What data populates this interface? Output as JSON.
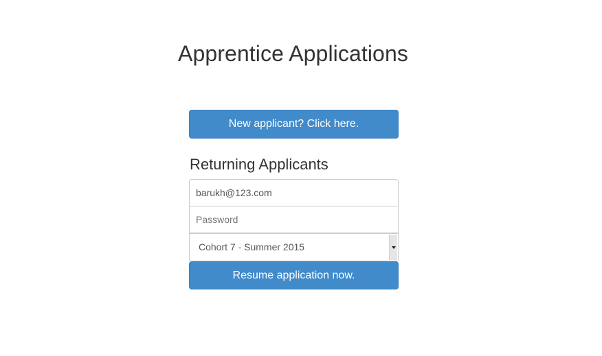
{
  "page": {
    "title": "Apprentice Applications"
  },
  "new_applicant": {
    "button_label": "New applicant? Click here."
  },
  "returning": {
    "heading": "Returning Applicants",
    "email_value": "barukh@123.com",
    "password_placeholder": "Password",
    "cohort_selected": "Cohort 7 - Summer 2015",
    "resume_button_label": "Resume application now."
  },
  "colors": {
    "primary": "#428bca",
    "text": "#333333",
    "border": "#cccccc"
  },
  "icons": {
    "select_arrow": "caret-down-icon"
  }
}
